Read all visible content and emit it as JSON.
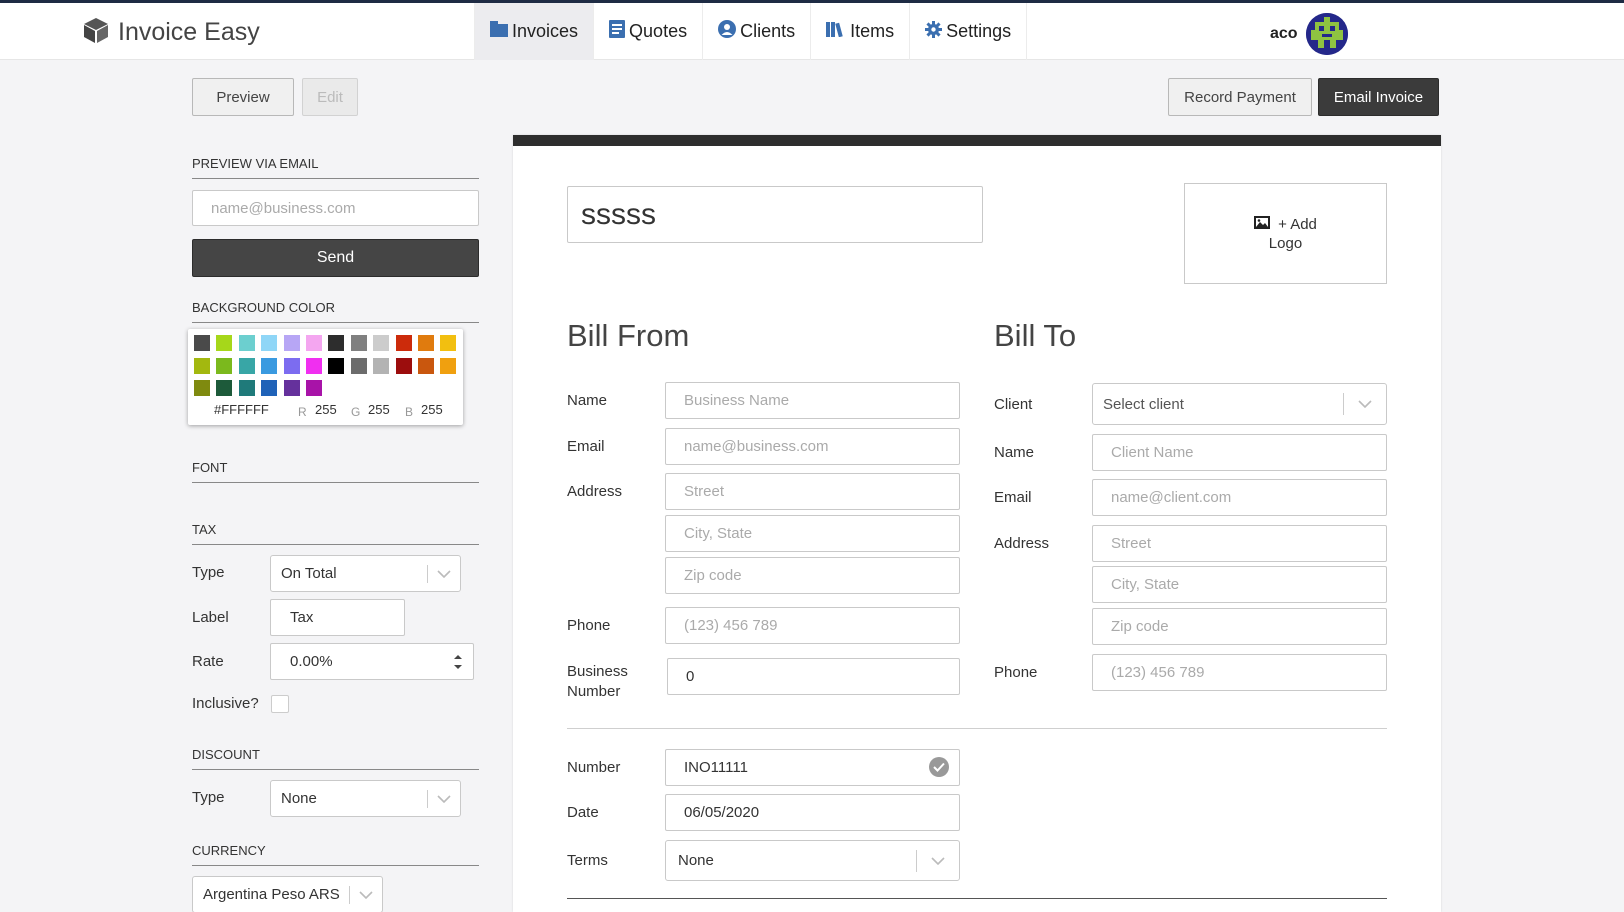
{
  "app": {
    "name": "Invoice Easy"
  },
  "nav": [
    {
      "label": "Invoices",
      "icon": "invoice-icon",
      "active": true
    },
    {
      "label": "Quotes",
      "icon": "quote-icon"
    },
    {
      "label": "Clients",
      "icon": "client-icon"
    },
    {
      "label": "Items",
      "icon": "items-icon"
    },
    {
      "label": "Settings",
      "icon": "gear-icon"
    }
  ],
  "user": {
    "name": "aco"
  },
  "toolbar": {
    "preview": "Preview",
    "edit": "Edit",
    "record_payment": "Record Payment",
    "email_invoice": "Email Invoice"
  },
  "sidebar": {
    "preview_email": {
      "title": "PREVIEW VIA EMAIL",
      "placeholder": "name@business.com",
      "send": "Send"
    },
    "background_color": {
      "title": "BACKGROUND COLOR",
      "swatches": [
        [
          "#4a4a4a",
          "#a6d71a",
          "#6ccfcf",
          "#8fd6f7",
          "#b7a6f5",
          "#f4a6f0",
          "#2d2d2d",
          "#808080",
          "#cccccc",
          "#cc2b0b",
          "#e07b0e",
          "#f2bf10"
        ],
        [
          "#a3b80f",
          "#7bb91d",
          "#38a6a6",
          "#3a9ae0",
          "#7c6cf0",
          "#f02ff0",
          "#000000",
          "#6c6c6c",
          "#b3b3b3",
          "#9c0d0d",
          "#c9570e",
          "#f0a00f"
        ],
        [
          "#7f8a0f",
          "#1d5a3a",
          "#1f7a7a",
          "#1f62b8",
          "#65319c",
          "#a813a8"
        ]
      ],
      "hex": "#FFFFFF",
      "r_label": "R",
      "r": "255",
      "g_label": "G",
      "g": "255",
      "b_label": "B",
      "b": "255"
    },
    "font": {
      "title": "FONT"
    },
    "tax": {
      "title": "TAX",
      "type_label": "Type",
      "type_value": "On Total",
      "label_label": "Label",
      "label_value": "Tax",
      "rate_label": "Rate",
      "rate_value": "0.00%",
      "inclusive_label": "Inclusive?"
    },
    "discount": {
      "title": "DISCOUNT",
      "type_label": "Type",
      "type_value": "None"
    },
    "currency": {
      "title": "CURRENCY",
      "value": "Argentina Peso ARS"
    }
  },
  "invoice": {
    "title": "sssss",
    "add_logo_line1": "+ Add",
    "add_logo_line2": "Logo",
    "bill_from": {
      "heading": "Bill From",
      "name_label": "Name",
      "name_placeholder": "Business Name",
      "email_label": "Email",
      "email_placeholder": "name@business.com",
      "address_label": "Address",
      "street_placeholder": "Street",
      "city_placeholder": "City, State",
      "zip_placeholder": "Zip code",
      "phone_label": "Phone",
      "phone_placeholder": "(123) 456 789",
      "business_number_label_1": "Business",
      "business_number_label_2": "Number",
      "business_number_value": "0"
    },
    "bill_to": {
      "heading": "Bill To",
      "client_label": "Client",
      "client_placeholder": "Select client",
      "name_label": "Name",
      "name_placeholder": "Client Name",
      "email_label": "Email",
      "email_placeholder": "name@client.com",
      "address_label": "Address",
      "street_placeholder": "Street",
      "city_placeholder": "City, State",
      "zip_placeholder": "Zip code",
      "phone_label": "Phone",
      "phone_placeholder": "(123) 456 789"
    },
    "meta": {
      "number_label": "Number",
      "number_value": "INO11111",
      "date_label": "Date",
      "date_value": "06/05/2020",
      "terms_label": "Terms",
      "terms_value": "None"
    }
  }
}
